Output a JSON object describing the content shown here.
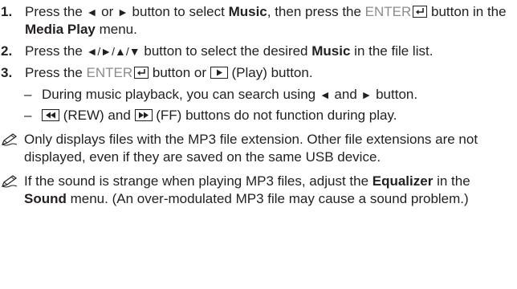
{
  "steps": [
    {
      "number": "1.",
      "p1": "Press the ",
      "left": "◄",
      "p2": " or ",
      "right": "►",
      "p3": " button to select ",
      "kw1": "Music",
      "p4": ", then press the ",
      "enter": "ENTER",
      "p5": " button in the ",
      "kw2": "Media Play",
      "p6": " menu."
    },
    {
      "number": "2.",
      "p1": "Press the ",
      "arrows": "◄/►/▲/▼",
      "p2": " button to select the desired ",
      "kw1": "Music",
      "p3": " in the file list."
    },
    {
      "number": "3.",
      "p1": "Press the ",
      "enter": "ENTER",
      "p2": " button or ",
      "p3": " (Play) button."
    }
  ],
  "sub_items": [
    {
      "dash": "–",
      "p1": "During music playback, you can search using ",
      "left": "◄",
      "p2": " and ",
      "right": "►",
      "p3": " button."
    },
    {
      "dash": "–",
      "p1": " (REW) and ",
      "p2": " (FF) buttons do not function during play."
    }
  ],
  "notes": [
    {
      "p1": "Only displays files with the MP3 file extension. Other file extensions are not displayed, even if they are saved on the same USB device."
    },
    {
      "p1": "If the sound is strange when playing MP3 files, adjust the ",
      "kw1": "Equalizer",
      "p2": " in the ",
      "kw2": "Sound",
      "p3": " menu. (An over-modulated MP3 file may cause a sound problem.)"
    }
  ],
  "icons": {
    "note": "pencil-note-icon",
    "enter": "enter-key-icon",
    "play": "play-button-icon",
    "rew": "rewind-button-icon",
    "ff": "fast-forward-button-icon"
  },
  "colors": {
    "text": "#231f20",
    "enter_label": "#8a8c8e"
  }
}
